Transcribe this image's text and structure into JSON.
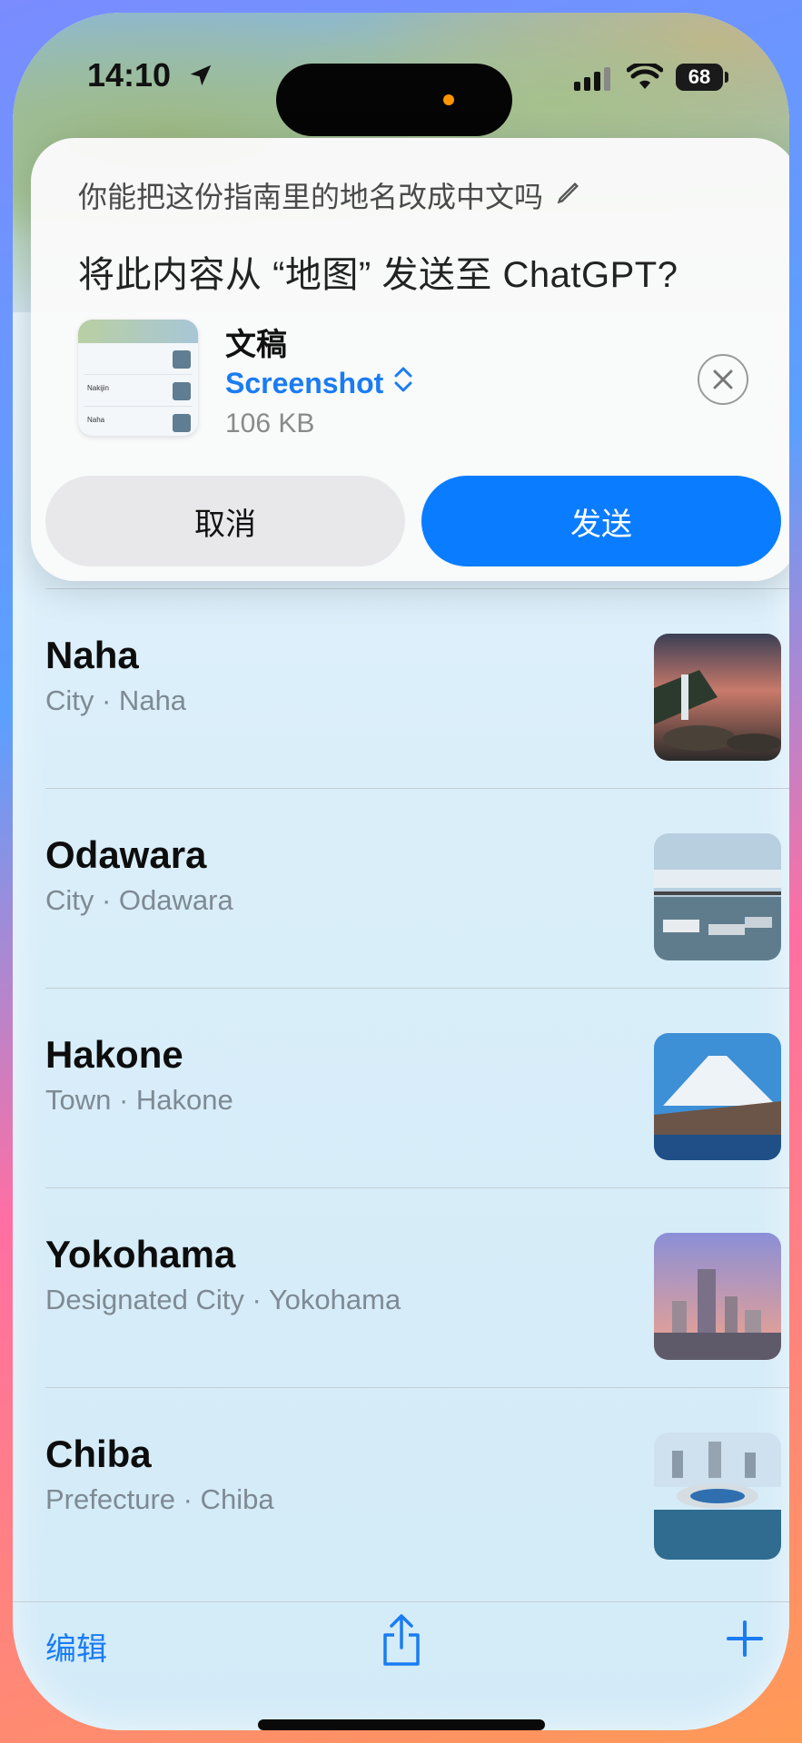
{
  "status_bar": {
    "time": "14:10",
    "battery": "68"
  },
  "share_sheet": {
    "prompt": "你能把这份指南里的地名改成中文吗",
    "question": "将此内容从 “地图” 发送至 ChatGPT?",
    "attachment": {
      "title": "文稿",
      "type_label": "Screenshot",
      "size": "106 KB",
      "thumb_rows": [
        "Nakijin",
        "Naha"
      ]
    },
    "cancel_label": "取消",
    "send_label": "发送"
  },
  "places": [
    {
      "name": "Naha",
      "subtitle": "City · Naha",
      "image": "waterfall-sunset-photo"
    },
    {
      "name": "Odawara",
      "subtitle": "City · Odawara",
      "image": "harbor-boats-photo"
    },
    {
      "name": "Hakone",
      "subtitle": "Town · Hakone",
      "image": "mount-fuji-photo"
    },
    {
      "name": "Yokohama",
      "subtitle": "Designated City · Yokohama",
      "image": "city-skyline-photo"
    },
    {
      "name": "Chiba",
      "subtitle": "Prefecture · Chiba",
      "image": "stadium-coast-photo"
    }
  ],
  "toolbar": {
    "edit_label": "编辑"
  },
  "colors": {
    "accent": "#0a7cff",
    "link": "#1a7cf2"
  }
}
